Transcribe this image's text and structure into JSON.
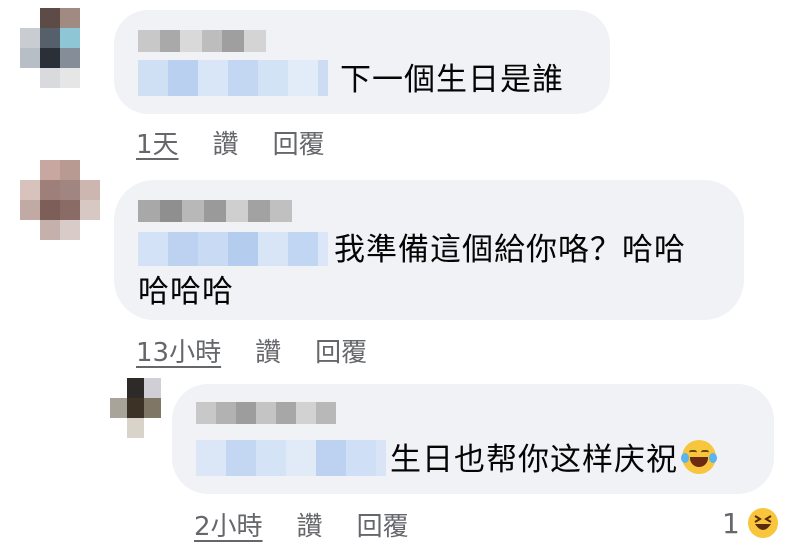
{
  "comments": [
    {
      "text_line1": "下一個生日是誰",
      "text_line2": "",
      "time": "1天",
      "like": "讚",
      "reply": "回覆"
    },
    {
      "text_line1": "我準備這個給你咯？哈哈",
      "text_line2": "哈哈哈",
      "time": "13小時",
      "like": "讚",
      "reply": "回覆"
    },
    {
      "text_line1": "生日也帮你这样庆祝",
      "text_line2": "",
      "time": "2小時",
      "like": "讚",
      "reply": "回覆",
      "emoji": "laughing-tears-icon"
    }
  ],
  "reaction": {
    "count": "1",
    "icon": "laughing-squint-icon"
  }
}
